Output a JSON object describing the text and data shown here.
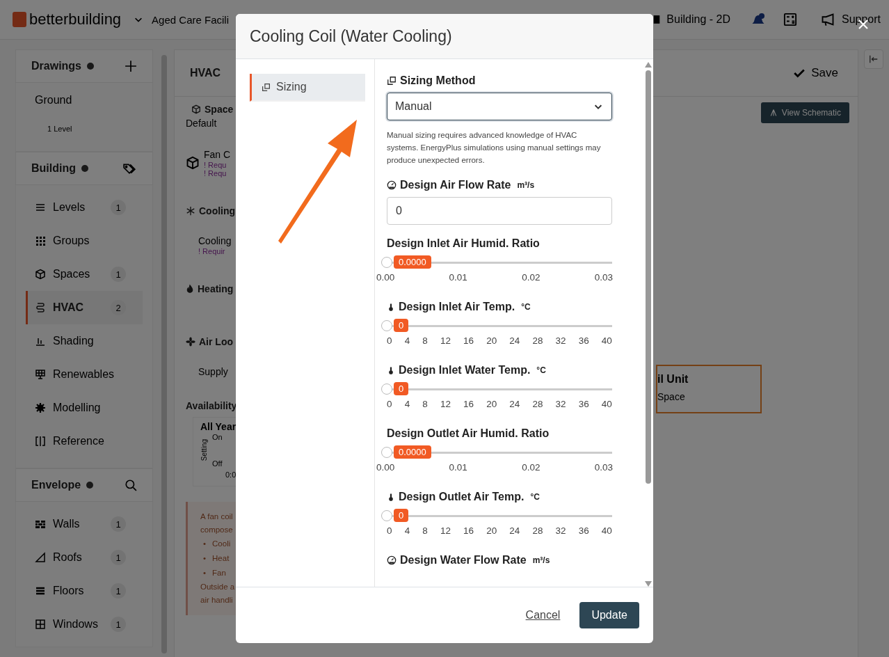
{
  "top_bar": {
    "brand": "betterbuilding",
    "project": "Aged Care Facili",
    "view": "Building - 2D",
    "support": "Support"
  },
  "sidebar": {
    "sections": [
      {
        "title": "Drawings",
        "items": [
          {
            "label": "Ground",
            "sub": "1 Level",
            "selected": false
          }
        ]
      },
      {
        "title": "Building",
        "items": [
          {
            "label": "Levels",
            "count": "1",
            "selected": false
          },
          {
            "label": "Groups",
            "selected": false
          },
          {
            "label": "Spaces",
            "count": "1",
            "selected": false
          },
          {
            "label": "HVAC",
            "count": "2",
            "selected": true
          },
          {
            "label": "Shading",
            "selected": false
          },
          {
            "label": "Renewables",
            "selected": false
          },
          {
            "label": "Modelling",
            "selected": false
          },
          {
            "label": "Reference",
            "selected": false
          }
        ]
      },
      {
        "title": "Envelope",
        "items": [
          {
            "label": "Walls",
            "count": "1",
            "selected": false
          },
          {
            "label": "Roofs",
            "count": "1",
            "selected": false
          },
          {
            "label": "Floors",
            "count": "1",
            "selected": false
          },
          {
            "label": "Windows",
            "count": "1",
            "selected": false
          }
        ]
      }
    ]
  },
  "main": {
    "title": "HVAC",
    "save": "Save",
    "view_schematic": "View Schematic",
    "items": [
      {
        "kind": "heading",
        "text": "Space"
      },
      {
        "kind": "text",
        "text": "Default"
      },
      {
        "kind": "device",
        "text": "Fan C",
        "warnings": [
          "! Requ",
          "! Requ"
        ]
      },
      {
        "kind": "heading",
        "text": "Cooling"
      },
      {
        "kind": "sub",
        "text": "Cooling",
        "warnings": [
          "! Requir"
        ]
      },
      {
        "kind": "heading",
        "text": "Heating"
      },
      {
        "kind": "heading",
        "text": "Air Loo"
      },
      {
        "kind": "sub",
        "text": "Supply"
      },
      {
        "kind": "section",
        "text": "Availability"
      }
    ],
    "availability": {
      "title": "All Year",
      "axis_label": "Setting",
      "on": "On",
      "off": "Off",
      "time": "0:0"
    },
    "info": {
      "lines": [
        "A fan coil",
        "compose"
      ],
      "marker": "•",
      "bullets": [
        "Cooli",
        "Heat",
        "Fan"
      ],
      "after": [
        "Outside a",
        "air handli"
      ]
    },
    "node": {
      "title": "il Unit",
      "sub": "Space"
    }
  },
  "dialog": {
    "title": "Cooling Coil (Water Cooling)",
    "tabs": [
      {
        "label": "Sizing",
        "selected": true
      }
    ],
    "fields": [
      {
        "kind": "select",
        "label": "Sizing Method",
        "value": "Manual",
        "help": "Manual sizing requires advanced knowledge of HVAC systems. EnergyPlus simulations using manual settings may produce unexpected errors."
      },
      {
        "kind": "number",
        "label": "Design Air Flow Rate",
        "unit": "m³/s",
        "value": "0"
      },
      {
        "kind": "slider",
        "label": "Design Inlet Air Humid. Ratio",
        "value": "0.0000",
        "level": 0,
        "ticks": [
          "0.00",
          "0.01",
          "0.02",
          "0.03"
        ]
      },
      {
        "kind": "slider",
        "label": "Design Inlet Air Temp.",
        "unit": "°C",
        "value": "0",
        "level": 0,
        "ticks": [
          "0",
          "4",
          "8",
          "12",
          "16",
          "20",
          "24",
          "28",
          "32",
          "36",
          "40"
        ]
      },
      {
        "kind": "slider",
        "label": "Design Inlet Water Temp.",
        "unit": "°C",
        "value": "0",
        "level": 0,
        "ticks": [
          "0",
          "4",
          "8",
          "12",
          "16",
          "20",
          "24",
          "28",
          "32",
          "36",
          "40"
        ]
      },
      {
        "kind": "slider",
        "label": "Design Outlet Air Humid. Ratio",
        "value": "0.0000",
        "level": 0,
        "ticks": [
          "0.00",
          "0.01",
          "0.02",
          "0.03"
        ]
      },
      {
        "kind": "slider",
        "label": "Design Outlet Air Temp.",
        "unit": "°C",
        "value": "0",
        "level": 0,
        "ticks": [
          "0",
          "4",
          "8",
          "12",
          "16",
          "20",
          "24",
          "28",
          "32",
          "36",
          "40"
        ]
      },
      {
        "kind": "number",
        "label": "Design Water Flow Rate",
        "unit": "m³/s"
      }
    ],
    "cancel": "Cancel",
    "update": "Update"
  }
}
